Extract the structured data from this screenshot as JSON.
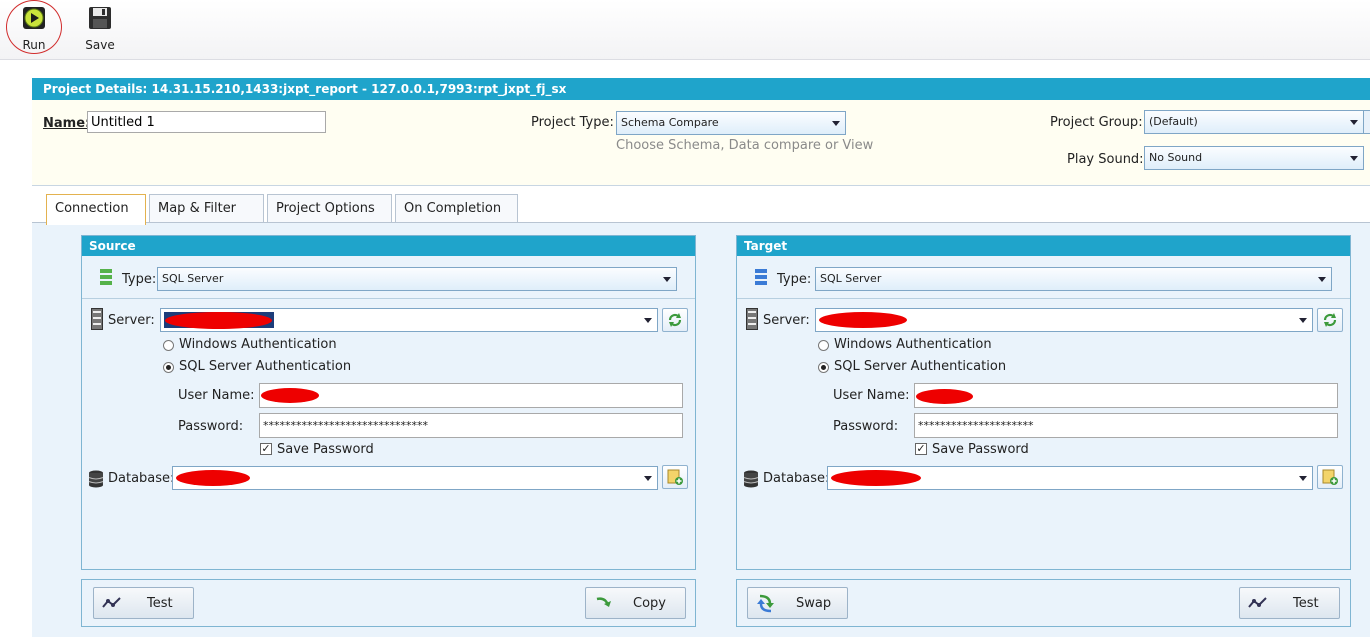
{
  "toolbar": {
    "run_label": "Run",
    "save_label": "Save"
  },
  "project": {
    "details_title": "Project Details: 14.31.15.210,1433:jxpt_report - 127.0.0.1,7993:rpt_jxpt_fj_sx",
    "name_label": "Name:",
    "name_value": "Untitled 1",
    "type_label": "Project Type:",
    "type_value": "Schema Compare",
    "type_hint": "Choose Schema, Data compare or View",
    "group_label": "Project Group:",
    "group_value": "(Default)",
    "sound_label": "Play Sound:",
    "sound_value": "No Sound"
  },
  "tabs": [
    {
      "label": "Connection"
    },
    {
      "label": "Map & Filter"
    },
    {
      "label": "Project Options"
    },
    {
      "label": "On Completion"
    }
  ],
  "source": {
    "title": "Source",
    "type_label": "Type:",
    "type_value": "SQL Server",
    "server_label": "Server:",
    "windows_auth_label": "Windows Authentication",
    "sql_auth_label": "SQL Server Authentication",
    "username_label": "User Name:",
    "password_label": "Password:",
    "password_value": "******************************",
    "save_password_label": "Save Password",
    "database_label": "Database:",
    "test_label": "Test",
    "copy_label": "Copy"
  },
  "target": {
    "title": "Target",
    "type_label": "Type:",
    "type_value": "SQL Server",
    "server_label": "Server:",
    "windows_auth_label": "Windows Authentication",
    "sql_auth_label": "SQL Server Authentication",
    "username_label": "User Name:",
    "password_label": "Password:",
    "password_value": "*********************",
    "save_password_label": "Save Password",
    "database_label": "Database:",
    "swap_label": "Swap",
    "test_label": "Test"
  },
  "colors": {
    "header_blue": "#1fa4cb",
    "panel_bg": "#eaf3fb",
    "redaction": "#ee0000",
    "run_highlight": "#d12d2d"
  }
}
